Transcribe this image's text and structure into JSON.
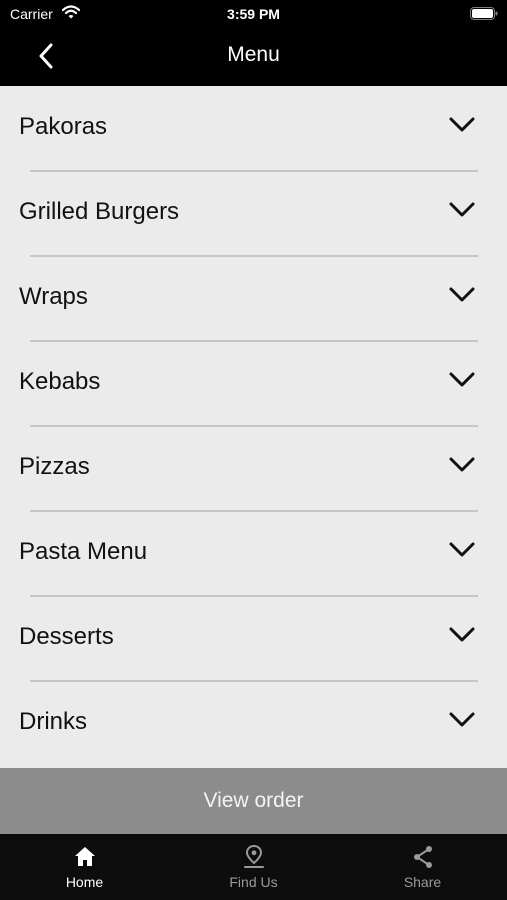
{
  "status_bar": {
    "carrier": "Carrier",
    "time": "3:59 PM"
  },
  "nav": {
    "title": "Menu",
    "back_icon": "chevron-left-icon"
  },
  "menu_items": [
    {
      "label": "Pakoras"
    },
    {
      "label": "Grilled Burgers"
    },
    {
      "label": "Wraps"
    },
    {
      "label": "Kebabs"
    },
    {
      "label": "Pizzas"
    },
    {
      "label": "Pasta Menu"
    },
    {
      "label": "Desserts"
    },
    {
      "label": "Drinks"
    }
  ],
  "view_order_label": "View order",
  "tabs": [
    {
      "label": "Home",
      "icon": "home-icon",
      "active": true
    },
    {
      "label": "Find Us",
      "icon": "location-pin-icon",
      "active": false
    },
    {
      "label": "Share",
      "icon": "share-icon",
      "active": false
    }
  ],
  "colors": {
    "nav_background": "#000000",
    "list_background": "#ebebeb",
    "view_order_background": "#8c8c8c",
    "tab_bar_background": "#0d0d0d"
  }
}
